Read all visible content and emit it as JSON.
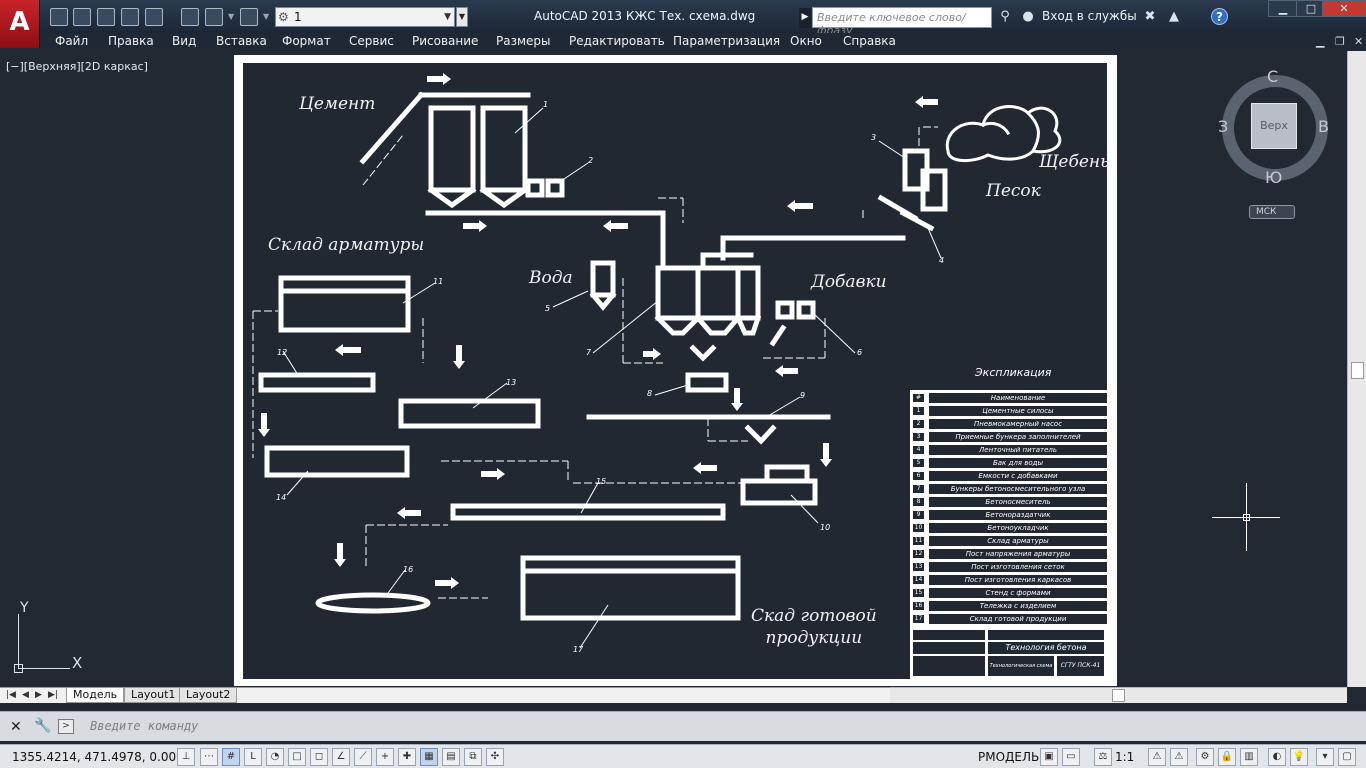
{
  "window": {
    "app_title": "AutoCAD 2013    КЖС Тех. схема.dwg",
    "workspace": "1",
    "search_placeholder": "Введите ключевое слово/фразу",
    "signin": "Вход в службы",
    "controls": {
      "minimize": "▁",
      "maximize": "□",
      "close": "✕"
    }
  },
  "menu": [
    "Файл",
    "Правка",
    "Вид",
    "Вставка",
    "Формат",
    "Сервис",
    "Рисование",
    "Размеры",
    "Редактировать",
    "Параметризация",
    "Окно",
    "Справка"
  ],
  "viewport": {
    "label": "[−][Верхняя][2D каркас]",
    "viewcube": {
      "face": "Верх",
      "north": "С",
      "south": "Ю",
      "west": "З",
      "east": "В"
    },
    "ucs_menu": "МСК",
    "ucs_axes": {
      "x": "X",
      "y": "Y"
    }
  },
  "drawing": {
    "labels": {
      "cement": "Цемент",
      "rebar_store": "Склад арматуры",
      "water": "Вода",
      "additives": "Добавки",
      "sand": "Песок",
      "gravel": "Щебень",
      "finished_store": "Скад готовой\nпродукции"
    },
    "numbers": [
      "1",
      "2",
      "3",
      "4",
      "5",
      "6",
      "7",
      "8",
      "9",
      "10",
      "11",
      "12",
      "13",
      "14",
      "15",
      "16",
      "17"
    ],
    "explication_title": "Экспликация",
    "explication": [
      {
        "n": "#",
        "t": "Наименование"
      },
      {
        "n": "1",
        "t": "Цементные силосы"
      },
      {
        "n": "2",
        "t": "Пневмокамерный насос"
      },
      {
        "n": "3",
        "t": "Приемные бункера заполнителей"
      },
      {
        "n": "4",
        "t": "Ленточный питатель"
      },
      {
        "n": "5",
        "t": "Бак для воды"
      },
      {
        "n": "6",
        "t": "Емкости с добавками"
      },
      {
        "n": "7",
        "t": "Бункеры бетоносмесительного узла"
      },
      {
        "n": "8",
        "t": "Бетоносмеситель"
      },
      {
        "n": "9",
        "t": "Бетонораздатчик"
      },
      {
        "n": "10",
        "t": "Бетоноукладчик"
      },
      {
        "n": "11",
        "t": "Склад арматуры"
      },
      {
        "n": "12",
        "t": "Пост напряжения арматуры"
      },
      {
        "n": "13",
        "t": "Пост изготовления сеток"
      },
      {
        "n": "14",
        "t": "Пост изготовления каркасов"
      },
      {
        "n": "15",
        "t": "Стенд с формами"
      },
      {
        "n": "16",
        "t": "Тележка с изделием"
      },
      {
        "n": "17",
        "t": "Склад готовой продукции"
      }
    ],
    "stamp": {
      "title": "Технология бетона",
      "org": "СГТУ ПСК-41",
      "doc": "Технологическая схема"
    }
  },
  "tabs": [
    "Модель",
    "Layout1",
    "Layout2"
  ],
  "command": {
    "placeholder": "Введите команду"
  },
  "status": {
    "coords": "1355.4214, 471.4978, 0.0000",
    "space": "РМОДЕЛЬ",
    "anno_scale": "1:1"
  }
}
